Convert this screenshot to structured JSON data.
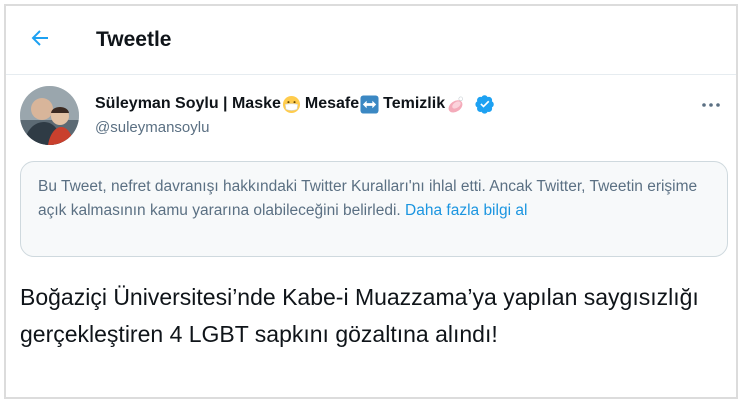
{
  "header": {
    "title": "Tweetle",
    "back_icon": "arrow-left-icon",
    "accent_color": "#1da1f2"
  },
  "author": {
    "name_part1": "Süleyman Soylu | Maske",
    "emoji1": "face-with-medical-mask-icon",
    "name_part2": "Mesafe",
    "emoji2": "left-right-arrow-icon",
    "name_part3": "Temizlik",
    "emoji3": "soap-icon",
    "verified_icon": "verified-badge-icon",
    "handle": "@suleymansoylu"
  },
  "more_icon": "more-dots-icon",
  "notice": {
    "text": "Bu Tweet, nefret davranışı hakkındaki Twitter Kuralları'nı ihlal etti. Ancak Twitter, Tweetin erişime açık kalmasının kamu yararına olabileceğini belirledi.",
    "link": "Daha fazla bilgi al",
    "link_color": "#1b95e0"
  },
  "tweet": {
    "text": "Boğaziçi Üniversitesi’nde Kabe-i Muazzama’ya yapılan saygısızlığı gerçekleştiren 4 LGBT sapkını gözaltına alındı!"
  }
}
